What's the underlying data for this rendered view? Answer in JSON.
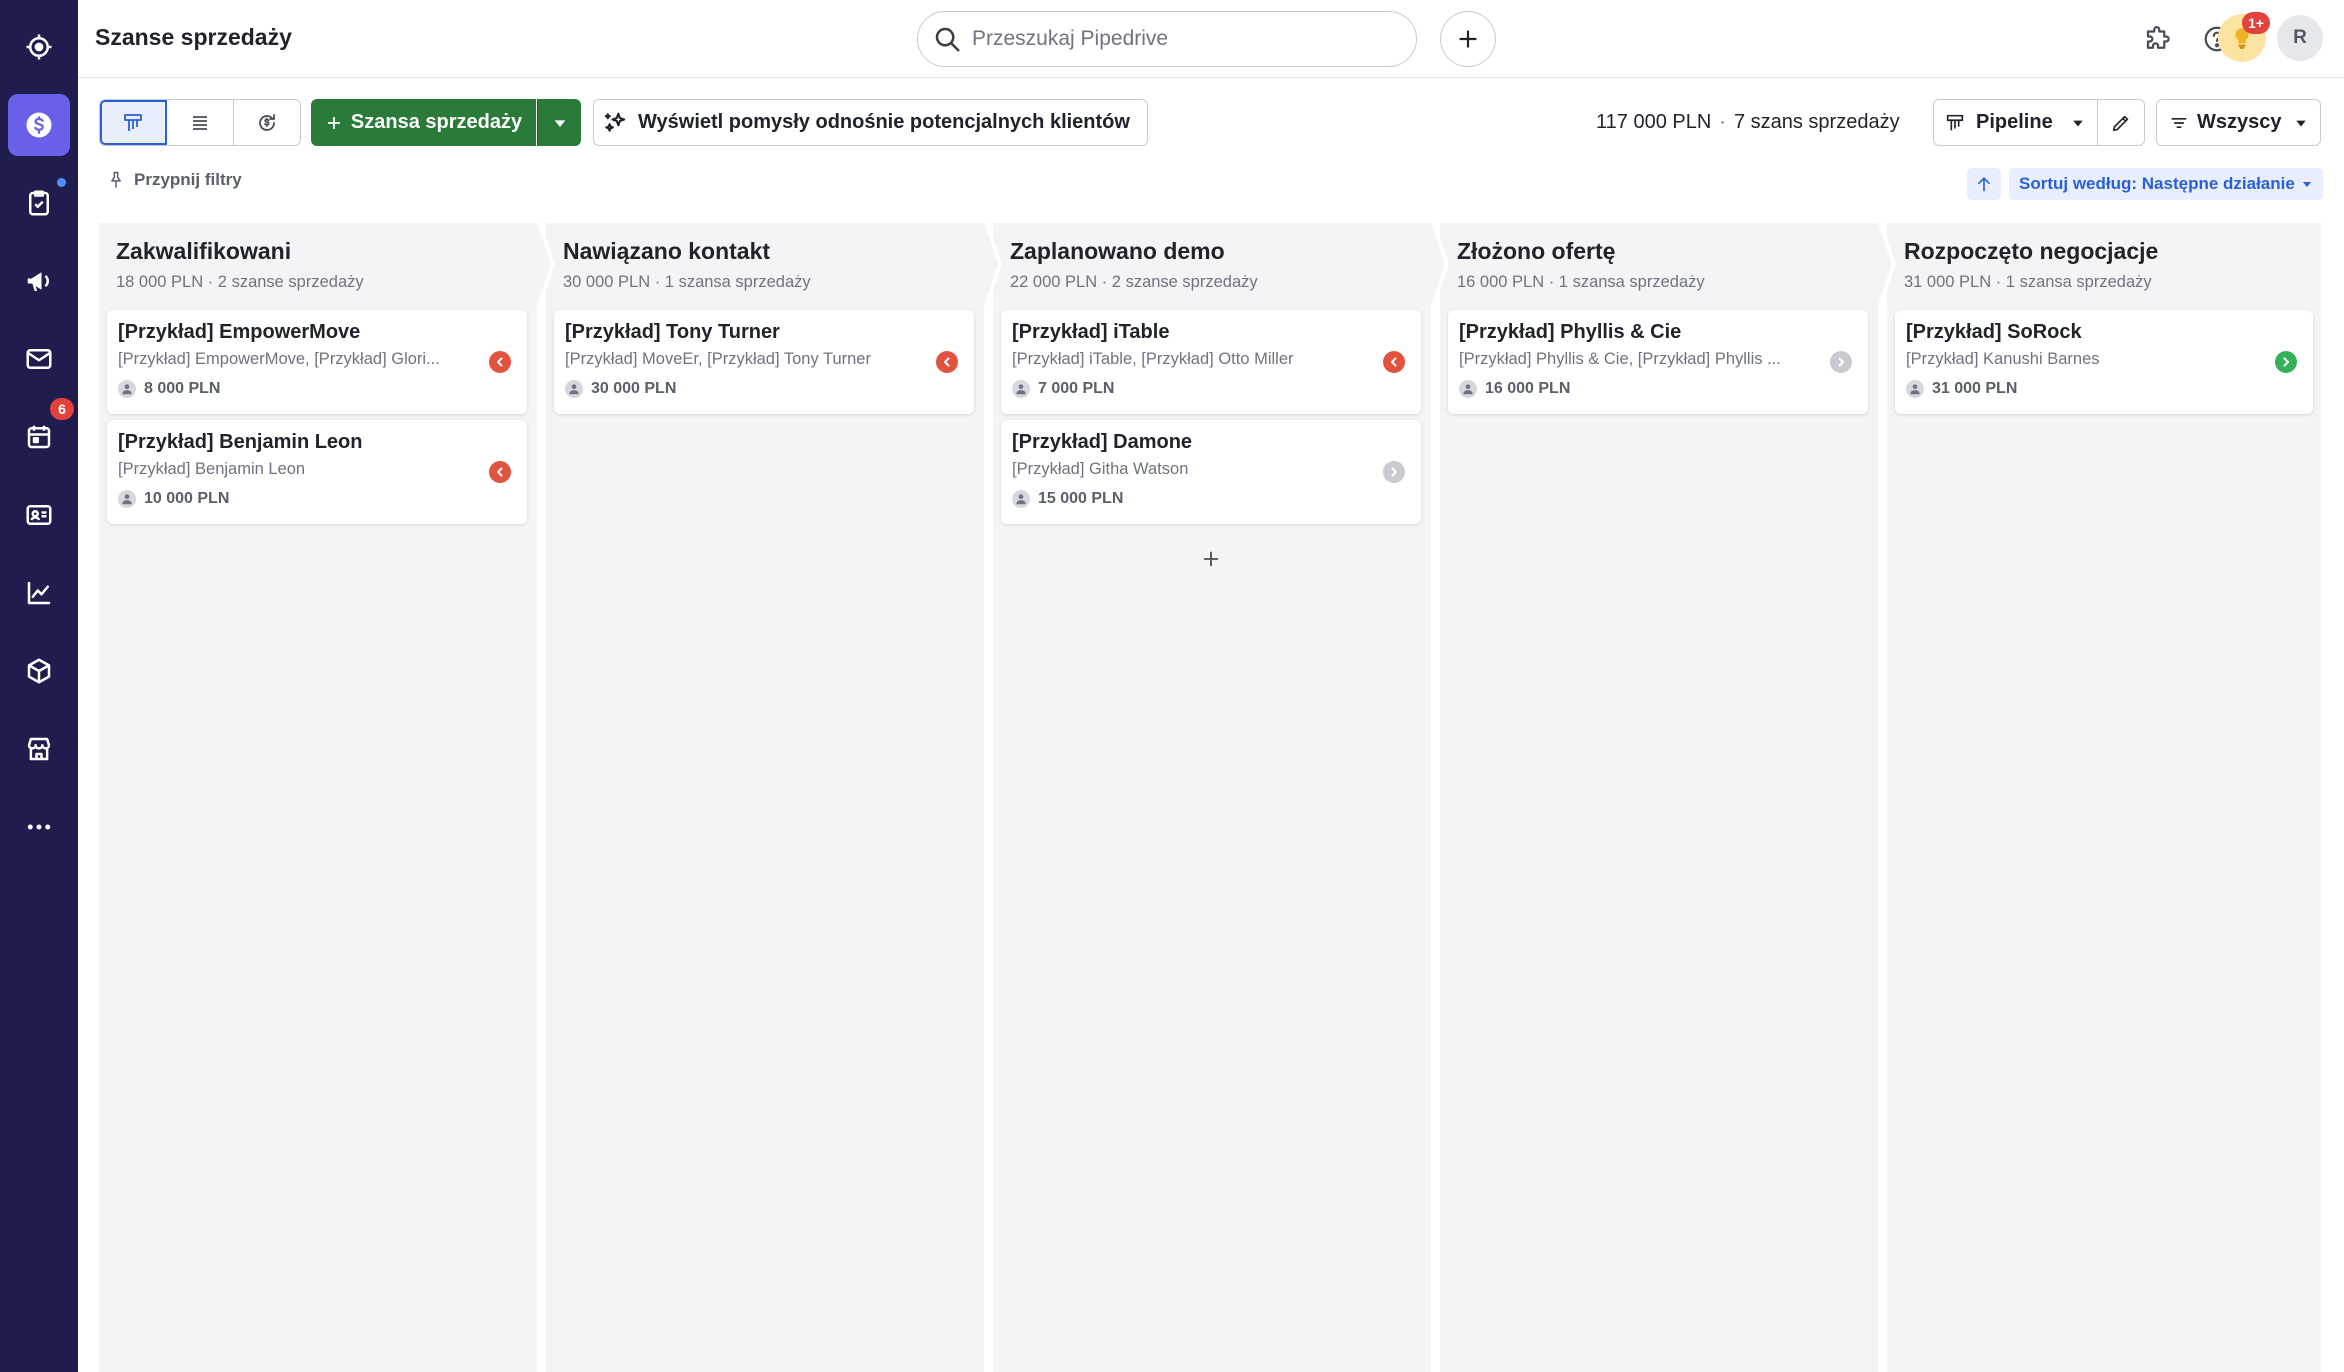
{
  "header": {
    "title": "Szanse sprzedaży",
    "search_placeholder": "Przeszukaj Pipedrive",
    "notifications_badge": "1+",
    "avatar_initial": "R"
  },
  "sidebar": {
    "items": [
      {
        "name": "focus",
        "icon": "target-icon"
      },
      {
        "name": "deals",
        "icon": "dollar-icon",
        "active": true
      },
      {
        "name": "activities",
        "icon": "clipboard-check-icon"
      },
      {
        "name": "campaigns",
        "icon": "megaphone-icon"
      },
      {
        "name": "mail",
        "icon": "mail-icon"
      },
      {
        "name": "calendar",
        "icon": "calendar-icon",
        "badge": "6"
      },
      {
        "name": "contacts",
        "icon": "contact-card-icon"
      },
      {
        "name": "insights",
        "icon": "chart-icon"
      },
      {
        "name": "products",
        "icon": "box-icon"
      },
      {
        "name": "marketplace",
        "icon": "store-icon"
      },
      {
        "name": "more",
        "icon": "more-icon"
      }
    ]
  },
  "toolbar": {
    "add_deal_label": "Szansa sprzedaży",
    "ideas_label": "Wyświetl pomysły odnośnie potencjalnych klientów",
    "summary_value": "117 000 PLN",
    "summary_sep": "·",
    "summary_count": "7 szans sprzedaży",
    "pipeline_label": "Pipeline",
    "owner_label": "Wszyscy",
    "pin_filters_label": "Przypnij filtry",
    "sort_label": "Sortuj według: Następne działanie"
  },
  "colors": {
    "sidebar_bg": "#1f1d4d",
    "accent": "#6860e8",
    "primary_green": "#2a7b3a",
    "link_blue": "#2b5fd9",
    "overdue_red": "#e2533f",
    "planned_green": "#38b05b",
    "no_activity_gray": "#c8cad0",
    "badge_red": "#e2413c"
  },
  "stages": [
    {
      "name": "Zakwalifikowani",
      "meta": "18 000 PLN · 2 szanse sprzedaży",
      "deals": [
        {
          "title": "[Przykład] EmpowerMove",
          "sub": "[Przykład] EmpowerMove, [Przykład] Glori...",
          "value": "8 000 PLN",
          "status": "overdue"
        },
        {
          "title": "[Przykład] Benjamin Leon",
          "sub": "[Przykład] Benjamin Leon",
          "value": "10 000 PLN",
          "status": "overdue"
        }
      ]
    },
    {
      "name": "Nawiązano kontakt",
      "meta": "30 000 PLN · 1 szansa sprzedaży",
      "deals": [
        {
          "title": "[Przykład] Tony Turner",
          "sub": "[Przykład] MoveEr, [Przykład] Tony Turner",
          "value": "30 000 PLN",
          "status": "overdue"
        }
      ]
    },
    {
      "name": "Zaplanowano demo",
      "meta": "22 000 PLN · 2 szanse sprzedaży",
      "deals": [
        {
          "title": "[Przykład] iTable",
          "sub": "[Przykład] iTable, [Przykład] Otto Miller",
          "value": "7 000 PLN",
          "status": "overdue"
        },
        {
          "title": "[Przykład] Damone",
          "sub": "[Przykład] Githa Watson",
          "value": "15 000 PLN",
          "status": "none"
        }
      ]
    },
    {
      "name": "Złożono ofertę",
      "meta": "16 000 PLN · 1 szansa sprzedaży",
      "deals": [
        {
          "title": "[Przykład] Phyllis & Cie",
          "sub": "[Przykład] Phyllis & Cie, [Przykład] Phyllis ...",
          "value": "16 000 PLN",
          "status": "none"
        }
      ]
    },
    {
      "name": "Rozpoczęto negocjacje",
      "meta": "31 000 PLN · 1 szansa sprzedaży",
      "deals": [
        {
          "title": "[Przykład] SoRock",
          "sub": "[Przykład] Kanushi Barnes",
          "value": "31 000 PLN",
          "status": "planned"
        }
      ]
    }
  ]
}
